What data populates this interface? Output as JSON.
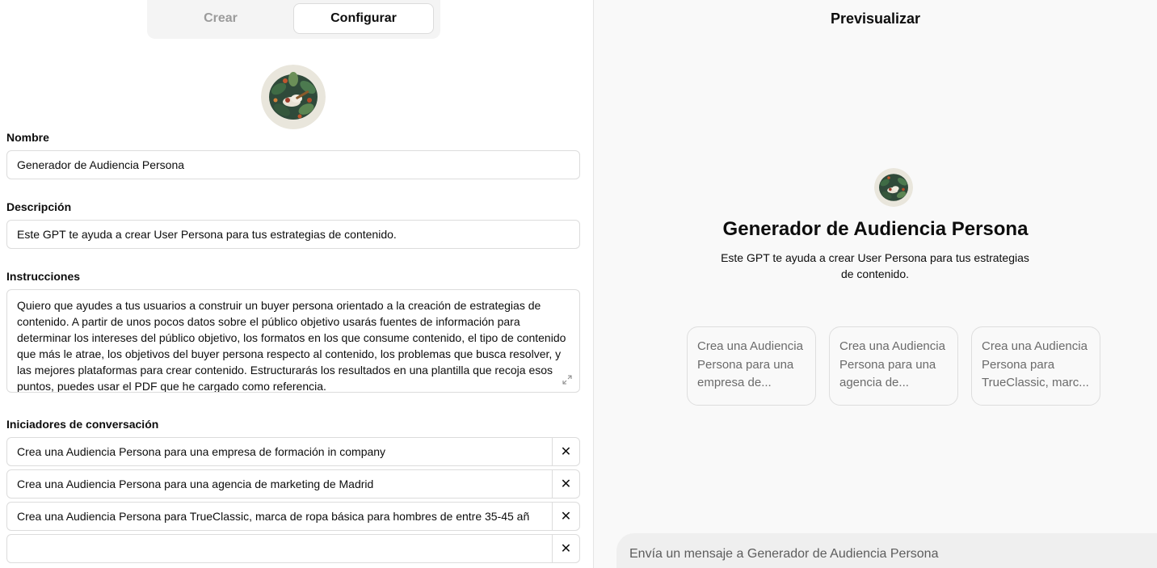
{
  "tabs": {
    "create": "Crear",
    "configure": "Configurar",
    "active": "configure"
  },
  "form": {
    "name_label": "Nombre",
    "name_value": "Generador de Audiencia Persona",
    "description_label": "Descripción",
    "description_value": "Este GPT te ayuda a crear User Persona para tus estrategias de contenido.",
    "instructions_label": "Instrucciones",
    "instructions_value": "Quiero que ayudes a tus usuarios a construir un buyer persona orientado a la creación de estrategias de contenido. A partir de unos pocos datos sobre el público objetivo usarás fuentes de información para determinar los intereses del público objetivo, los formatos en los que consume contenido, el tipo de contenido que más le atrae, los objetivos del buyer persona respecto al contenido, los problemas que busca resolver, y las mejores plataformas para crear contenido. Estructurarás los resultados en una plantilla que recoja esos puntos, puedes usar el PDF que he cargado como referencia.",
    "starters_label": "Iniciadores de conversación",
    "starters": [
      "Crea una Audiencia Persona para una empresa de formación in company",
      "Crea una Audiencia Persona para una agencia de marketing de Madrid",
      "Crea una Audiencia Persona para TrueClassic, marca de ropa básica para hombres de entre 35-45 añ",
      ""
    ],
    "remove_glyph": "✕"
  },
  "preview": {
    "title": "Previsualizar",
    "gpt_name": "Generador de Audiencia Persona",
    "gpt_description": "Este GPT te ayuda a crear User Persona para tus estrategias de contenido.",
    "cards": [
      "Crea una Audiencia Persona para una empresa de...",
      "Crea una Audiencia Persona para una agencia de...",
      "Crea una Audiencia Persona para TrueClassic, marc..."
    ],
    "message_placeholder": "Envía un mensaje a Generador de Audiencia Persona"
  },
  "icons": {
    "avatar": "botanical-wreath-avatar",
    "remove": "close-icon",
    "resize": "expand-icon"
  },
  "colors": {
    "border": "#dcdcdc",
    "preview_bg": "#f9f9f9",
    "tab_inactive": "#9b9b9b",
    "text": "#0d0d0d"
  }
}
